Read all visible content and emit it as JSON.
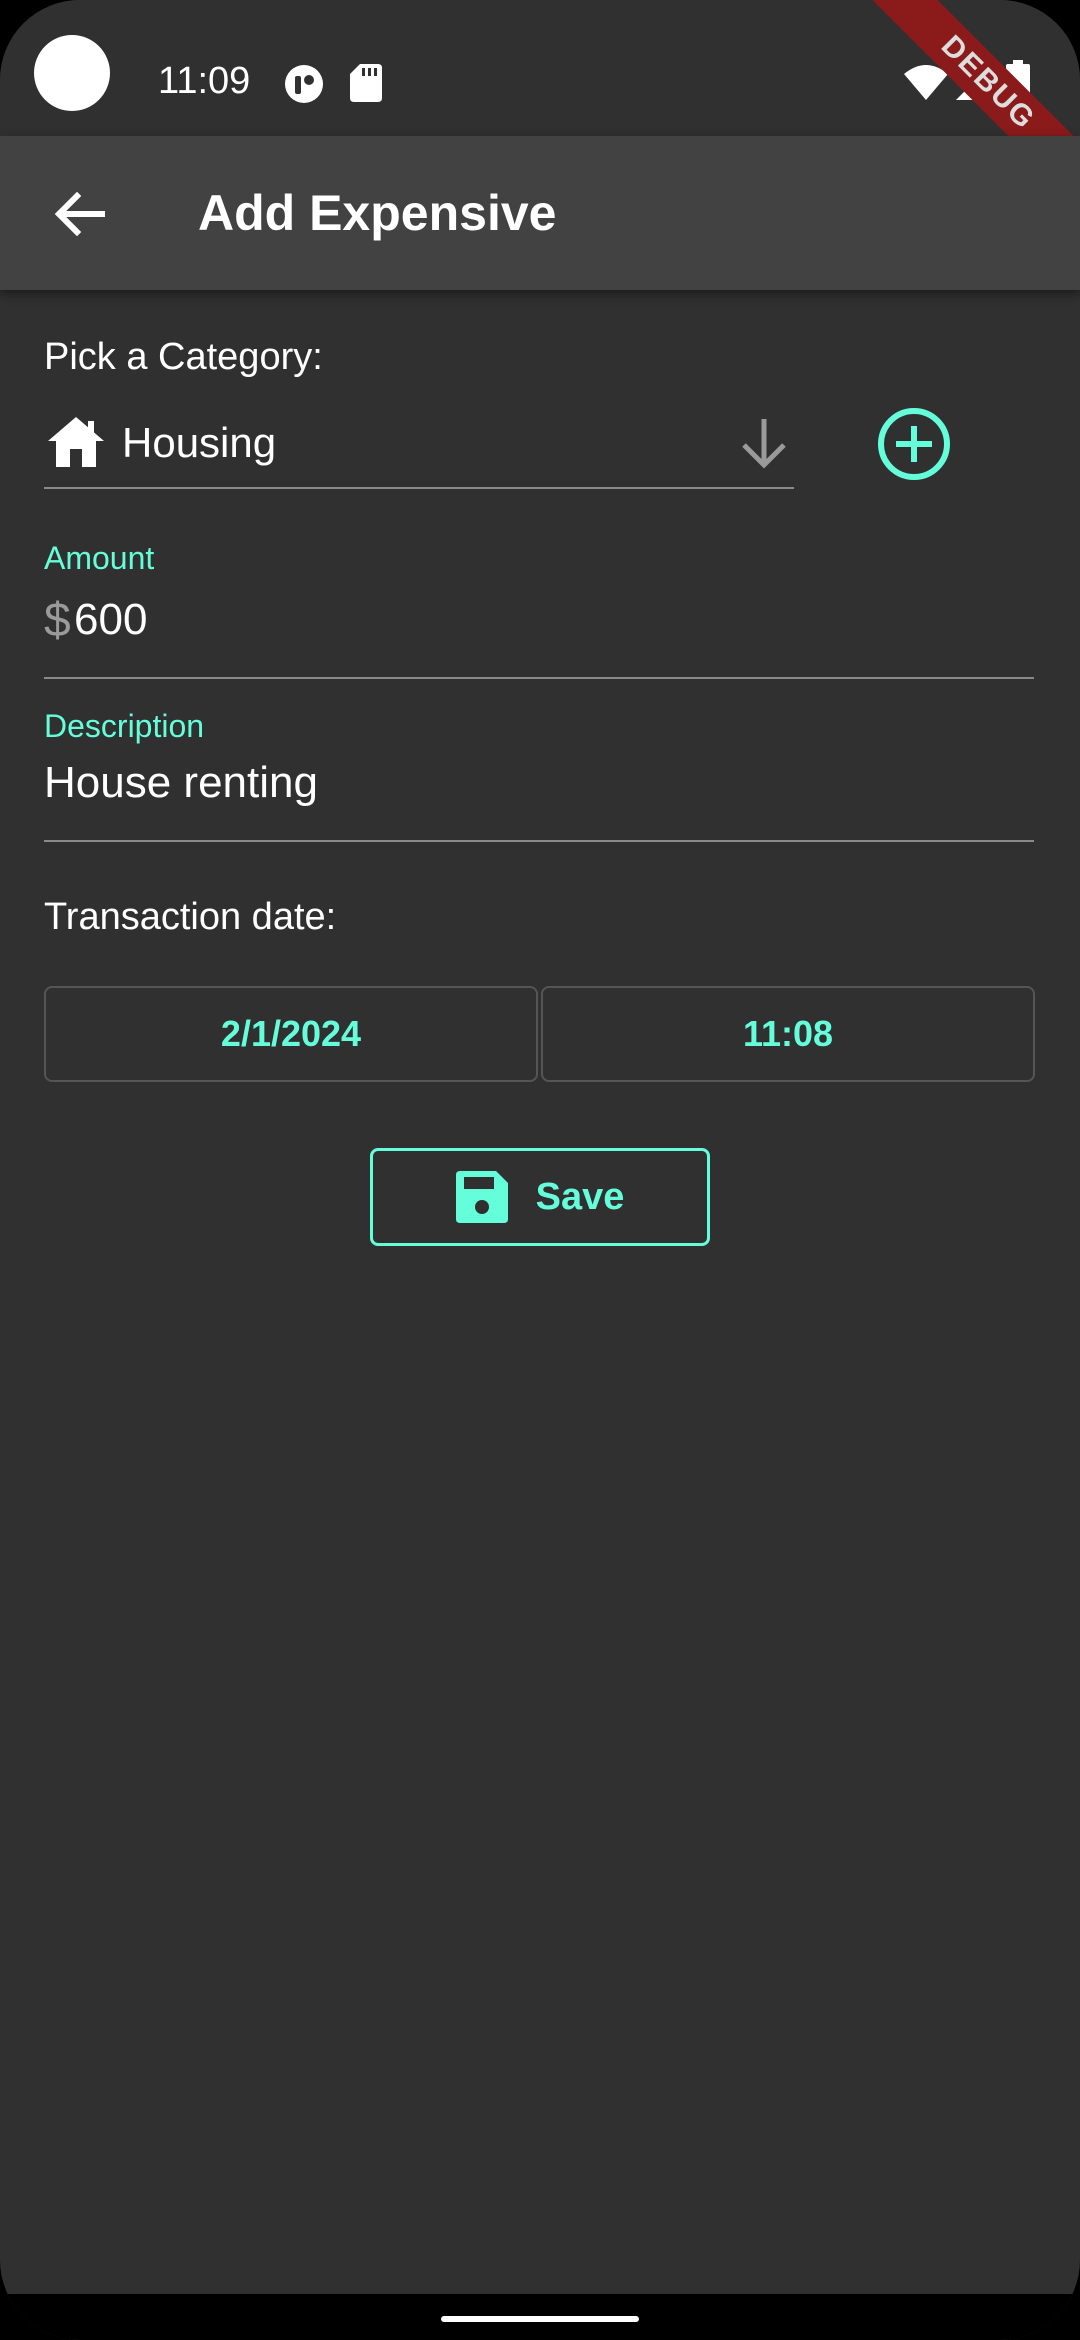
{
  "status_bar": {
    "time": "11:09",
    "icons": [
      "notification-icon",
      "sd-card-icon",
      "wifi-icon",
      "signal-icon",
      "battery-icon"
    ]
  },
  "debug_banner": "DEBUG",
  "app_bar": {
    "title": "Add Expensive",
    "back_icon": "arrow-back-icon"
  },
  "form": {
    "category_label": "Pick a Category:",
    "category": {
      "selected": "Housing",
      "icon": "house-icon"
    },
    "amount": {
      "label": "Amount",
      "prefix": "$",
      "value": "600"
    },
    "description": {
      "label": "Description",
      "value": "House renting"
    },
    "transaction_date_label": "Transaction date:",
    "date": "2/1/2024",
    "time": "11:08",
    "save_label": "Save"
  },
  "colors": {
    "accent": "#64ffda",
    "background": "#303030",
    "app_bar": "#424242"
  }
}
